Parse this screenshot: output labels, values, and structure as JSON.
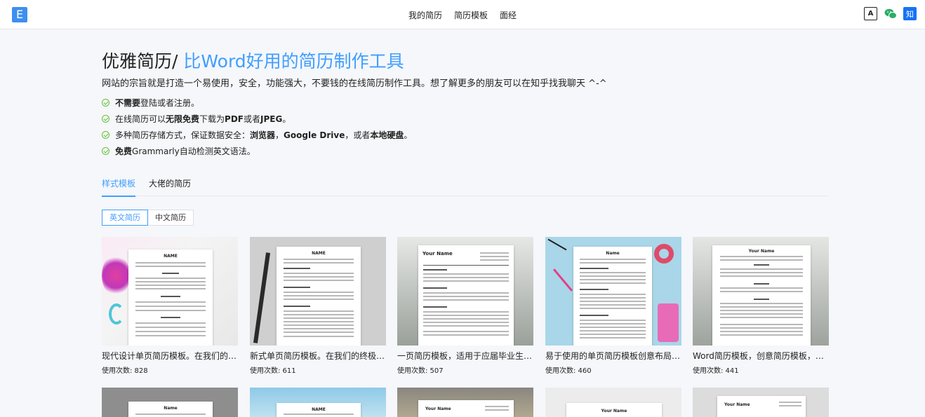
{
  "header": {
    "logo": "E",
    "nav": [
      "我的简历",
      "简历模板",
      "面经"
    ],
    "icons": [
      "translate-icon",
      "wechat-icon",
      "zhihu-icon"
    ],
    "zhihu_label": "知",
    "translate_label": "A"
  },
  "hero": {
    "title": "优雅简历/",
    "title_accent": "比Word好用的简历制作工具",
    "intro": "网站的宗旨就是打造一个易使用，安全，功能强大，不要钱的在线简历制作工具。想了解更多的朋友可以在知乎找我聊天 ^-^",
    "features": [
      {
        "bold": "不需要",
        "text": "登陆或者注册。"
      },
      {
        "pre": "在线简历可以",
        "bold": "无限免费",
        "mid": "下载为",
        "bold2": "PDF",
        "mid2": "或者",
        "bold3": "JPEG",
        "post": "。"
      },
      {
        "pre": "多种简历存储方式，保证数据安全：",
        "bold": "浏览器",
        "mid": "，",
        "bold2": "Google Drive",
        "mid2": "，或者",
        "bold3": "本地硬盘",
        "post": "。"
      },
      {
        "bold": "免费",
        "text": "Grammarly自动检测英文语法。"
      }
    ]
  },
  "tabs": [
    "样式模板",
    "大佬的简历"
  ],
  "segment": [
    "英文简历",
    "中文简历"
  ],
  "cards": [
    {
      "title": "现代设计单页简历模板。在我们的终极简历模板...",
      "uses": "使用次数: 828",
      "paper_name": "NAME"
    },
    {
      "title": "新式单页简历模板。在我们的终极简历模板...",
      "uses": "使用次数: 611",
      "paper_name": "NAME"
    },
    {
      "title": "一页简历模板，适用于应届毕业生/年轻人...",
      "uses": "使用次数: 507",
      "paper_name": "Your Name"
    },
    {
      "title": "易于使用的单页简历模板创意布局，结构清晰...",
      "uses": "使用次数: 460",
      "paper_name": "Name"
    },
    {
      "title": "Word简历模板，创意简历模板，现代简历模板",
      "uses": "使用次数: 441",
      "paper_name": "Your Name"
    }
  ],
  "cards_row2": [
    {
      "paper_name": "Name"
    },
    {
      "paper_name": "NAME"
    },
    {
      "paper_name": "Your Name"
    },
    {
      "paper_name": "Your Name"
    },
    {
      "paper_name": "Your Name"
    }
  ],
  "colors": {
    "accent": "#409eff",
    "check": "#67c23a"
  }
}
